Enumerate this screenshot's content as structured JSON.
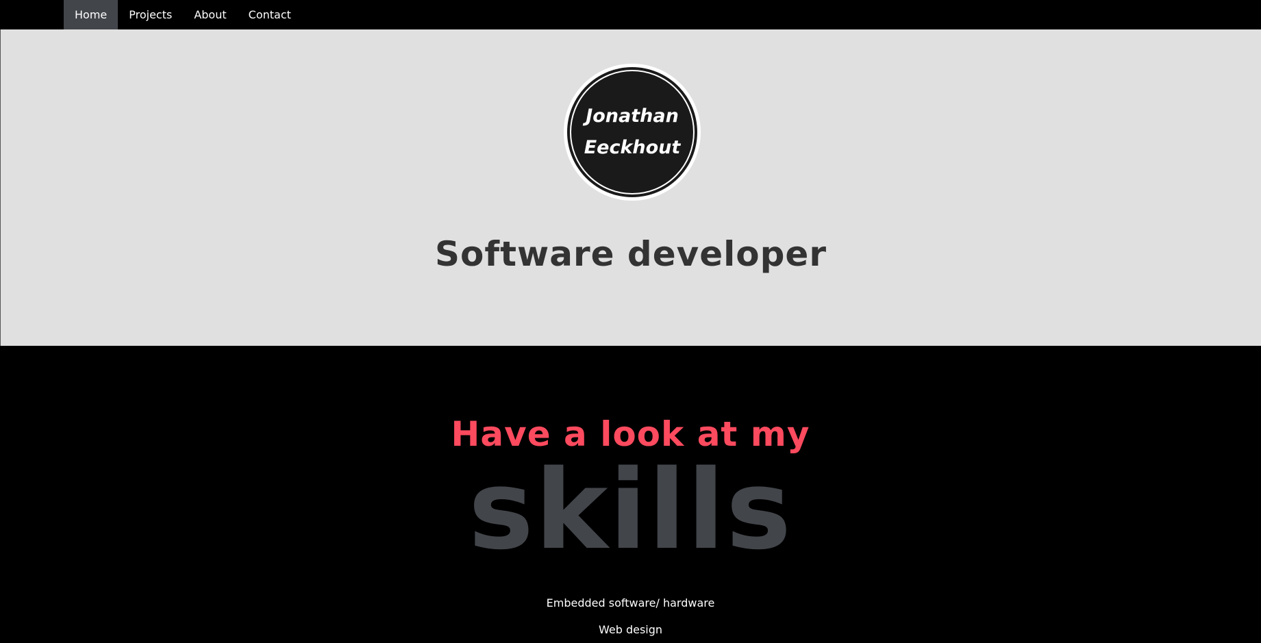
{
  "nav": {
    "items": [
      {
        "label": "Home",
        "active": true
      },
      {
        "label": "Projects",
        "active": false
      },
      {
        "label": "About",
        "active": false
      },
      {
        "label": "Contact",
        "active": false
      }
    ]
  },
  "hero": {
    "logo_line1": "Jonathan",
    "logo_line2": "Eeckhout",
    "title": "Software developer"
  },
  "skills": {
    "subtitle": "Have a look at my",
    "title": "skills",
    "items": [
      "Embedded software/ hardware",
      "Web design"
    ]
  },
  "colors": {
    "accent": "#fc4a5e",
    "hero_bg": "#e0e0e0",
    "nav_active": "#42454a",
    "skills_title": "#42454a"
  }
}
